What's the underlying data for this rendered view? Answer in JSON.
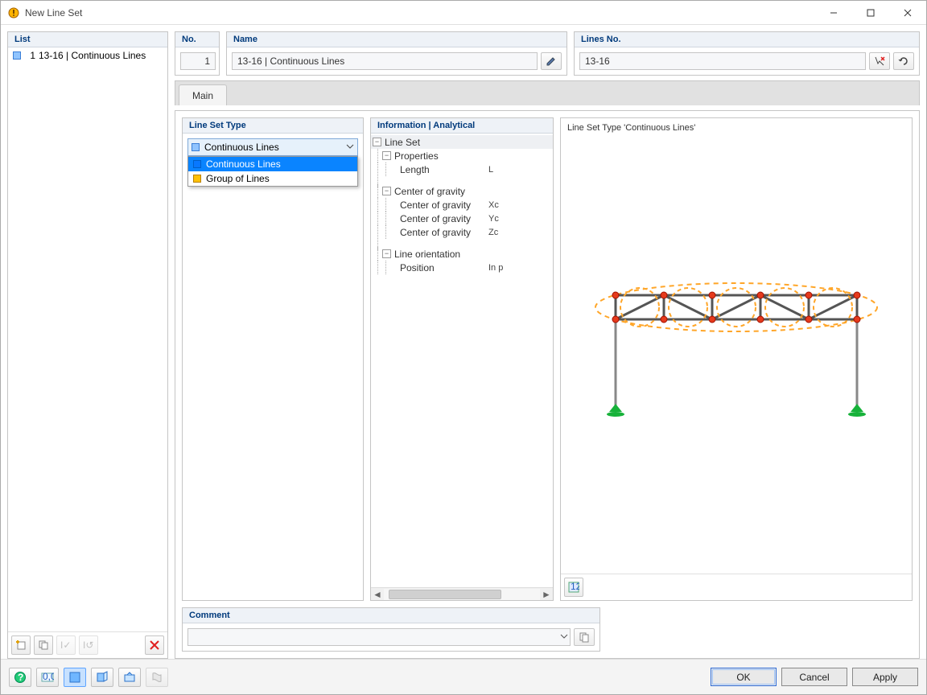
{
  "window": {
    "title": "New Line Set"
  },
  "list": {
    "header": "List",
    "item_no": "1",
    "item_label": "13-16 | Continuous Lines"
  },
  "fields": {
    "no_label": "No.",
    "no_value": "1",
    "name_label": "Name",
    "name_value": "13-16 | Continuous Lines",
    "lines_label": "Lines No.",
    "lines_value": "13-16"
  },
  "tabs": {
    "main": "Main"
  },
  "type_panel": {
    "header": "Line Set Type",
    "selected": "Continuous Lines",
    "opt1": "Continuous Lines",
    "opt2": "Group of Lines"
  },
  "info_panel": {
    "header": "Information | Analytical",
    "line_set": "Line Set",
    "properties": "Properties",
    "length": "Length",
    "length_sym": "L",
    "cog": "Center of gravity",
    "cogx": "Center of gravity",
    "cogx_sym": "Xc",
    "cogy": "Center of gravity",
    "cogy_sym": "Yc",
    "cogz": "Center of gravity",
    "cogz_sym": "Zc",
    "orient": "Line orientation",
    "position": "Position",
    "position_val": "In p"
  },
  "preview": {
    "title": "Line Set Type 'Continuous Lines'"
  },
  "comment": {
    "header": "Comment"
  },
  "footer": {
    "ok": "OK",
    "cancel": "Cancel",
    "apply": "Apply"
  }
}
